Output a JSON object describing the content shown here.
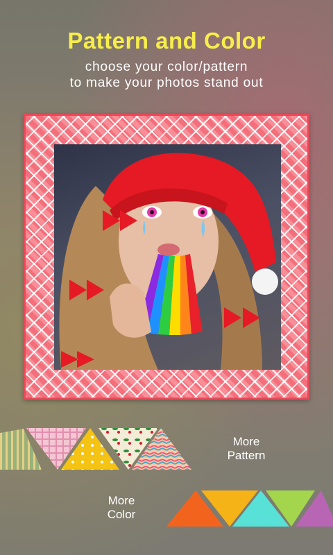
{
  "header": {
    "title": "Pattern and Color",
    "subtitle_line1": "choose your color/pattern",
    "subtitle_line2": "to make your photos stand out"
  },
  "preview": {
    "frame_pattern": "red-argyle-pattern",
    "photo": "girl-santa-hat-rainbow-photo"
  },
  "patterns": {
    "items": [
      "green-stripe-pattern",
      "pink-plaid-pattern",
      "yellow-hearts-pattern",
      "holly-pattern",
      "zigzag-pattern"
    ],
    "more_label_line1": "More",
    "more_label_line2": "Pattern"
  },
  "colors": {
    "items": [
      "#f2641e",
      "#f6b318",
      "#58e1d6",
      "#a3d54d",
      "#b865b4"
    ],
    "more_label_line1": "More",
    "more_label_line2": "Color"
  }
}
